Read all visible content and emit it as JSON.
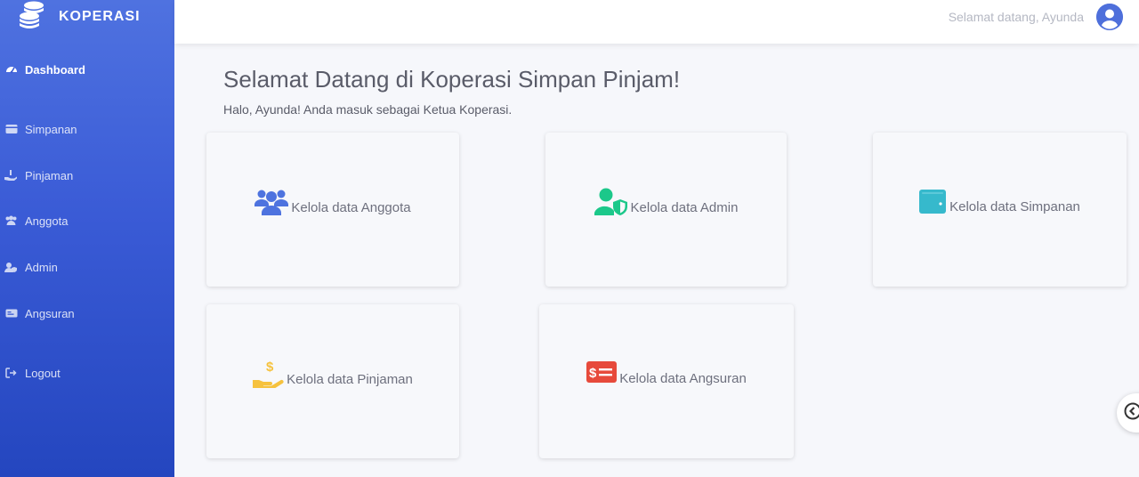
{
  "brand": {
    "name": "KOPERASI",
    "icon": "coins-icon"
  },
  "sidebar": {
    "items": [
      {
        "label": "Dashboard",
        "icon": "tachometer-icon",
        "active": true
      },
      {
        "label": "Simpanan",
        "icon": "card-icon"
      },
      {
        "label": "Pinjaman",
        "icon": "hand-holding-icon"
      },
      {
        "label": "Anggota",
        "icon": "users-icon"
      },
      {
        "label": "Admin",
        "icon": "user-shield-icon"
      },
      {
        "label": "Angsuran",
        "icon": "money-bill-icon"
      },
      {
        "label": "Logout",
        "icon": "sign-out-icon"
      }
    ]
  },
  "topbar": {
    "greeting": "Selamat datang, Ayunda",
    "avatar_icon": "user-circle-icon"
  },
  "main": {
    "title": "Selamat Datang di Koperasi Simpan Pinjam!",
    "subtitle": "Halo, Ayunda! Anda masuk sebagai Ketua Koperasi.",
    "cards": [
      {
        "label": "Kelola data Anggota",
        "icon": "users-icon",
        "color": "#4e73df"
      },
      {
        "label": "Kelola data Admin",
        "icon": "user-shield-icon",
        "color": "#1cc88a"
      },
      {
        "label": "Kelola data Simpanan",
        "icon": "wallet-icon",
        "color": "#36b9cc"
      },
      {
        "label": "Kelola data Pinjaman",
        "icon": "hand-holding-usd-icon",
        "color": "#f6c23e"
      },
      {
        "label": "Kelola data Angsuran",
        "icon": "money-check-icon",
        "color": "#e74a3b"
      }
    ]
  },
  "colors": {
    "sidebar_top": "#4f72e0",
    "sidebar_bottom": "#2446bf",
    "page_background": "#f6f7fb"
  }
}
